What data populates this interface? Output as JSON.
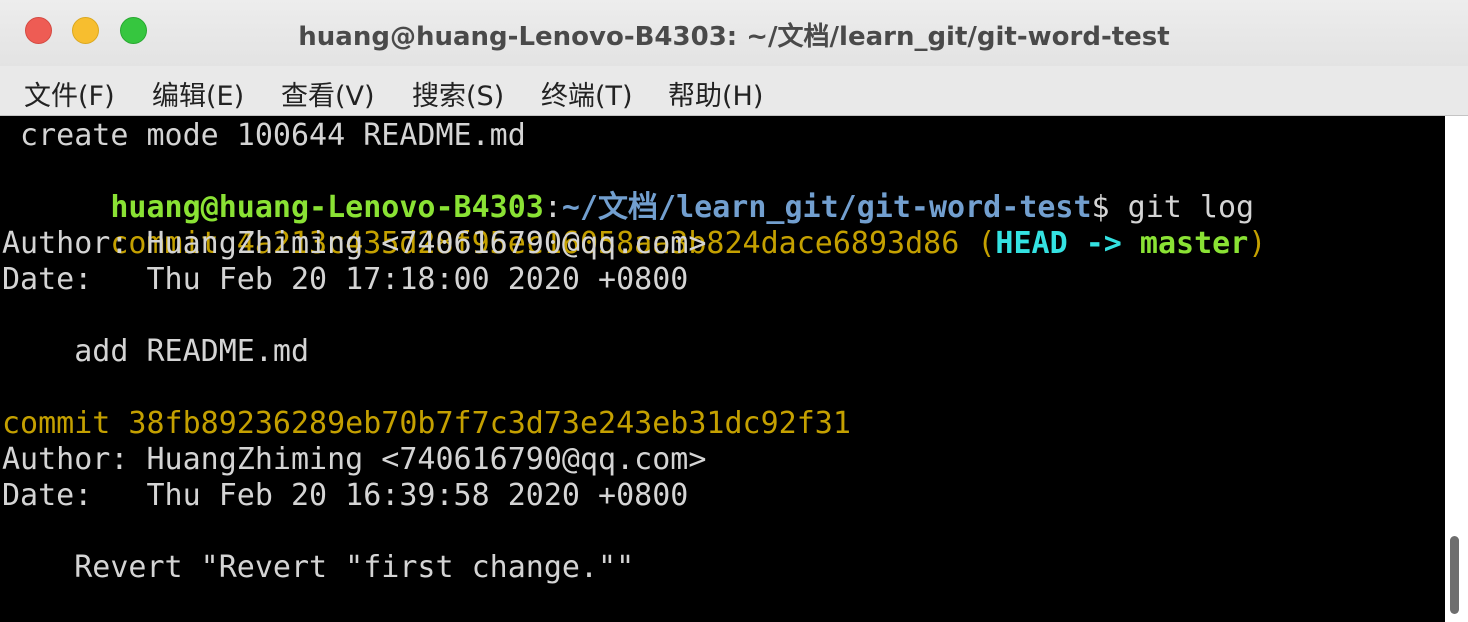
{
  "window": {
    "title": "huang@huang-Lenovo-B4303: ~/文档/learn_git/git-word-test"
  },
  "menu": {
    "items": [
      "文件(F)",
      "编辑(E)",
      "查看(V)",
      "搜索(S)",
      "终端(T)",
      "帮助(H)"
    ]
  },
  "terminal": {
    "line0": " create mode 100644 README.md",
    "prompt_user": "huang@huang-Lenovo-B4303",
    "prompt_colon": ":",
    "prompt_path": "~/文档/learn_git/git-word-test",
    "prompt_dollar": "$ ",
    "command": "git log",
    "commit1_prefix": "commit 4a213c435d28f95ec16058aa3b824dace6893d86 ",
    "commit1_paren_open": "(",
    "commit1_head": "HEAD -> ",
    "commit1_branch": "master",
    "commit1_paren_close": ")",
    "commit1_author": "Author: HuangZhiming <740616790@qq.com>",
    "commit1_date": "Date:   Thu Feb 20 17:18:00 2020 +0800",
    "commit1_message": "    add README.md",
    "commit2_line": "commit 38fb89236289eb70b7f7c3d73e243eb31dc92f31",
    "commit2_author": "Author: HuangZhiming <740616790@qq.com>",
    "commit2_date": "Date:   Thu Feb 20 16:39:58 2020 +0800",
    "commit2_message": "    Revert \"Revert \"first change.\"\""
  },
  "colors": {
    "background": "#000000",
    "text": "#d4d4d4",
    "prompt_user": "#8ae234",
    "prompt_path": "#729fcf",
    "commit_hash": "#c4a000",
    "head_ref": "#34e2e2",
    "branch_ref": "#8ae234"
  }
}
